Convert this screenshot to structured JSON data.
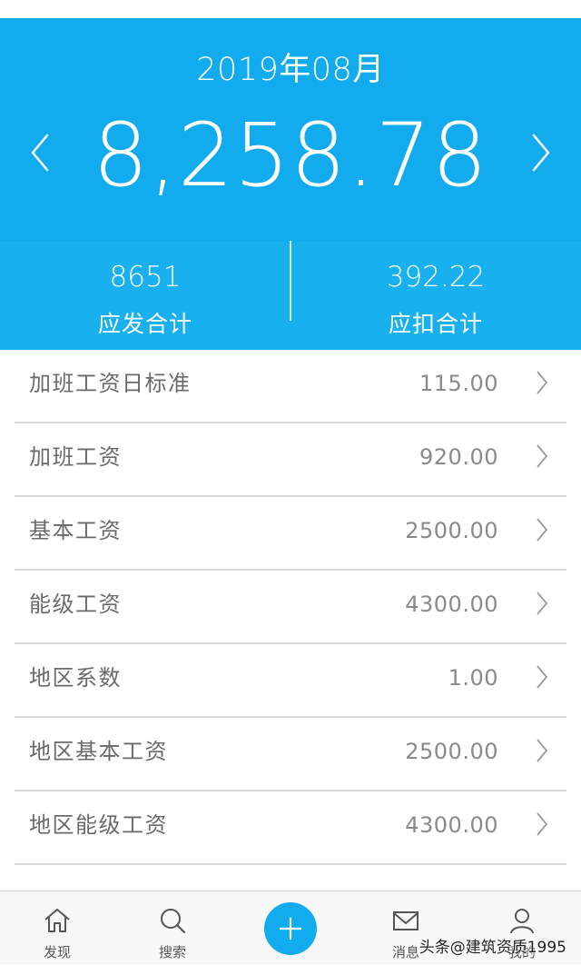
{
  "header": {
    "month": "2019年08月",
    "net_amount": "8,258.78",
    "prev_icon": "chevron-left-icon",
    "next_icon": "chevron-right-icon"
  },
  "summary": {
    "gross_total": "8651",
    "gross_label": "应发合计",
    "deduction_total": "392.22",
    "deduction_label": "应扣合计"
  },
  "items": [
    {
      "label": "加班工资日标准",
      "value": "115.00"
    },
    {
      "label": "加班工资",
      "value": "920.00"
    },
    {
      "label": "基本工资",
      "value": "2500.00"
    },
    {
      "label": "能级工资",
      "value": "4300.00"
    },
    {
      "label": "地区系数",
      "value": "1.00"
    },
    {
      "label": "地区基本工资",
      "value": "2500.00"
    },
    {
      "label": "地区能级工资",
      "value": "4300.00"
    }
  ],
  "tabbar": {
    "home_label": "发现",
    "search_label": "搜索",
    "messages_label": "消息",
    "me_label": "我的"
  },
  "watermark": "头条@建筑资质1995",
  "colors": {
    "accent": "#12acee",
    "header_bg": "#12acee",
    "summary_bg": "#19b0ef",
    "label_text": "#6a6a6a",
    "value_text": "#8a8a8a"
  }
}
